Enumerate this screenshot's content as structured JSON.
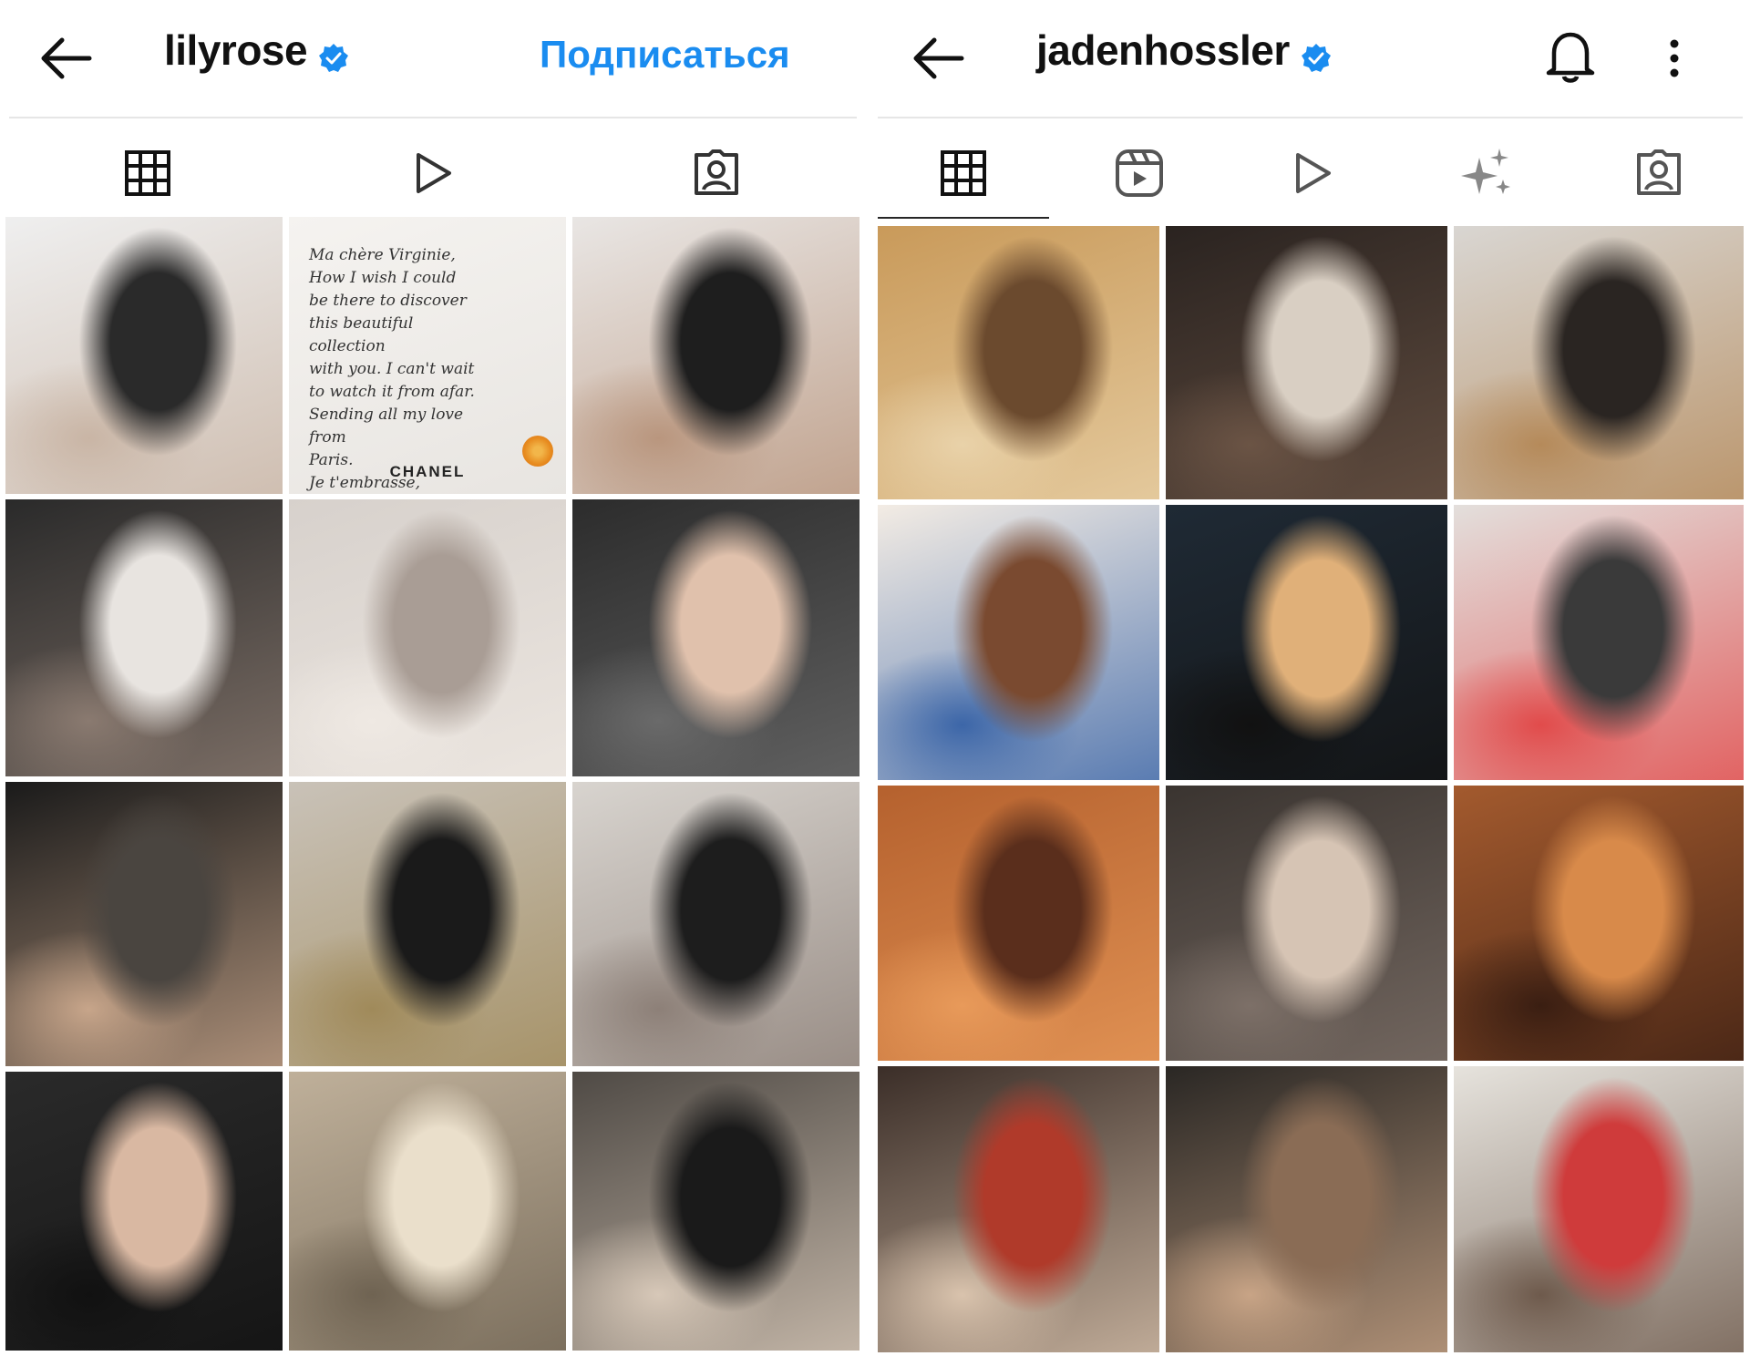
{
  "accent": "#1a8cf0",
  "left_profile": {
    "username": "lilyrose",
    "verified": true,
    "follow_label": "Подписаться",
    "icons": [
      "back-arrow-icon",
      "verified-badge-icon",
      "grid-icon",
      "reels-play-icon",
      "tagged-icon"
    ],
    "posts": [
      {
        "desc": "pose-black-top",
        "colors": [
          "#efefef",
          "#2a2a2a",
          "#c9b5a5"
        ]
      },
      {
        "desc": "chanel-letter",
        "colors": [
          "#f1efec",
          "#333",
          "#e79a2e"
        ],
        "note": "Ma chère Virginie,\nHow I wish I could\nbe there to discover\nthis beautiful collection\nwith you. I can't wait\nto watch it from afar.\nSending all my love from\nParis.\n   Je t'embrasse,\n      Lily-Rose",
        "caption": "CHANEL"
      },
      {
        "desc": "camera-book",
        "colors": [
          "#e9e6e4",
          "#1e1e1e",
          "#b9967e"
        ]
      },
      {
        "desc": "white-corset-mirror",
        "colors": [
          "#2a2a2a",
          "#e8e4e0",
          "#8a7a70"
        ]
      },
      {
        "desc": "foggy-mirror",
        "colors": [
          "#d7d1cc",
          "#a99d95",
          "#efe9e3"
        ]
      },
      {
        "desc": "car-portrait",
        "colors": [
          "#2c2c2c",
          "#e0c1ac",
          "#6a6a6a"
        ]
      },
      {
        "desc": "night-street",
        "colors": [
          "#1a1a1a",
          "#4a4540",
          "#c7a58a"
        ]
      },
      {
        "desc": "black-dress-wall",
        "colors": [
          "#c9c2b8",
          "#1a1a1a",
          "#a08a5a"
        ]
      },
      {
        "desc": "suit-mirror",
        "colors": [
          "#d8d4cf",
          "#1d1d1d",
          "#8d8078"
        ]
      },
      {
        "desc": "car-selfie",
        "colors": [
          "#2a2a2a",
          "#d9b8a2",
          "#111"
        ]
      },
      {
        "desc": "book-lamp",
        "colors": [
          "#bfb09a",
          "#eadfcb",
          "#6f6352"
        ]
      },
      {
        "desc": "desk-reading",
        "colors": [
          "#4f4a45",
          "#1a1a1a",
          "#d7c8b8"
        ]
      }
    ]
  },
  "right_profile": {
    "username": "jadenhossler",
    "verified": true,
    "icons": [
      "back-arrow-icon",
      "verified-badge-icon",
      "bell-icon",
      "more-vertical-icon",
      "grid-icon",
      "reels-icon",
      "play-icon",
      "sparkles-icon",
      "tagged-icon"
    ],
    "posts": [
      {
        "desc": "tongue-out-sunset",
        "colors": [
          "#c99a5a",
          "#6b4a2e",
          "#e9d2a9"
        ]
      },
      {
        "desc": "friends-kiss",
        "colors": [
          "#2a2320",
          "#d9cfc3",
          "#6b5445"
        ]
      },
      {
        "desc": "leather-jacket",
        "colors": [
          "#d9d6d2",
          "#2a2522",
          "#b58a5a"
        ]
      },
      {
        "desc": "hoodie-hug",
        "colors": [
          "#f3ece4",
          "#7a4a30",
          "#3c66a8"
        ]
      },
      {
        "desc": "mannequin",
        "colors": [
          "#1f2a35",
          "#e0b079",
          "#111"
        ]
      },
      {
        "desc": "couch-kiss",
        "colors": [
          "#e3dfdc",
          "#3a3a3a",
          "#e14b4b"
        ]
      },
      {
        "desc": "orange-room-drink",
        "colors": [
          "#b5612e",
          "#5a2e1c",
          "#e89a5a"
        ]
      },
      {
        "desc": "bed-friends",
        "colors": [
          "#3a3430",
          "#d6c4b4",
          "#7d7068"
        ]
      },
      {
        "desc": "plaid-couch",
        "colors": [
          "#a35a2e",
          "#d88a4a",
          "#3a1e12"
        ]
      },
      {
        "desc": "redhead-kiss",
        "colors": [
          "#3b2e28",
          "#b03a2a",
          "#d9c3ad"
        ]
      },
      {
        "desc": "shirtless-street",
        "colors": [
          "#2a2724",
          "#8a6c55",
          "#c8a486"
        ]
      },
      {
        "desc": "red-paint-selfie",
        "colors": [
          "#e6e3dd",
          "#cf3b3b",
          "#6e5a4c"
        ]
      }
    ]
  }
}
